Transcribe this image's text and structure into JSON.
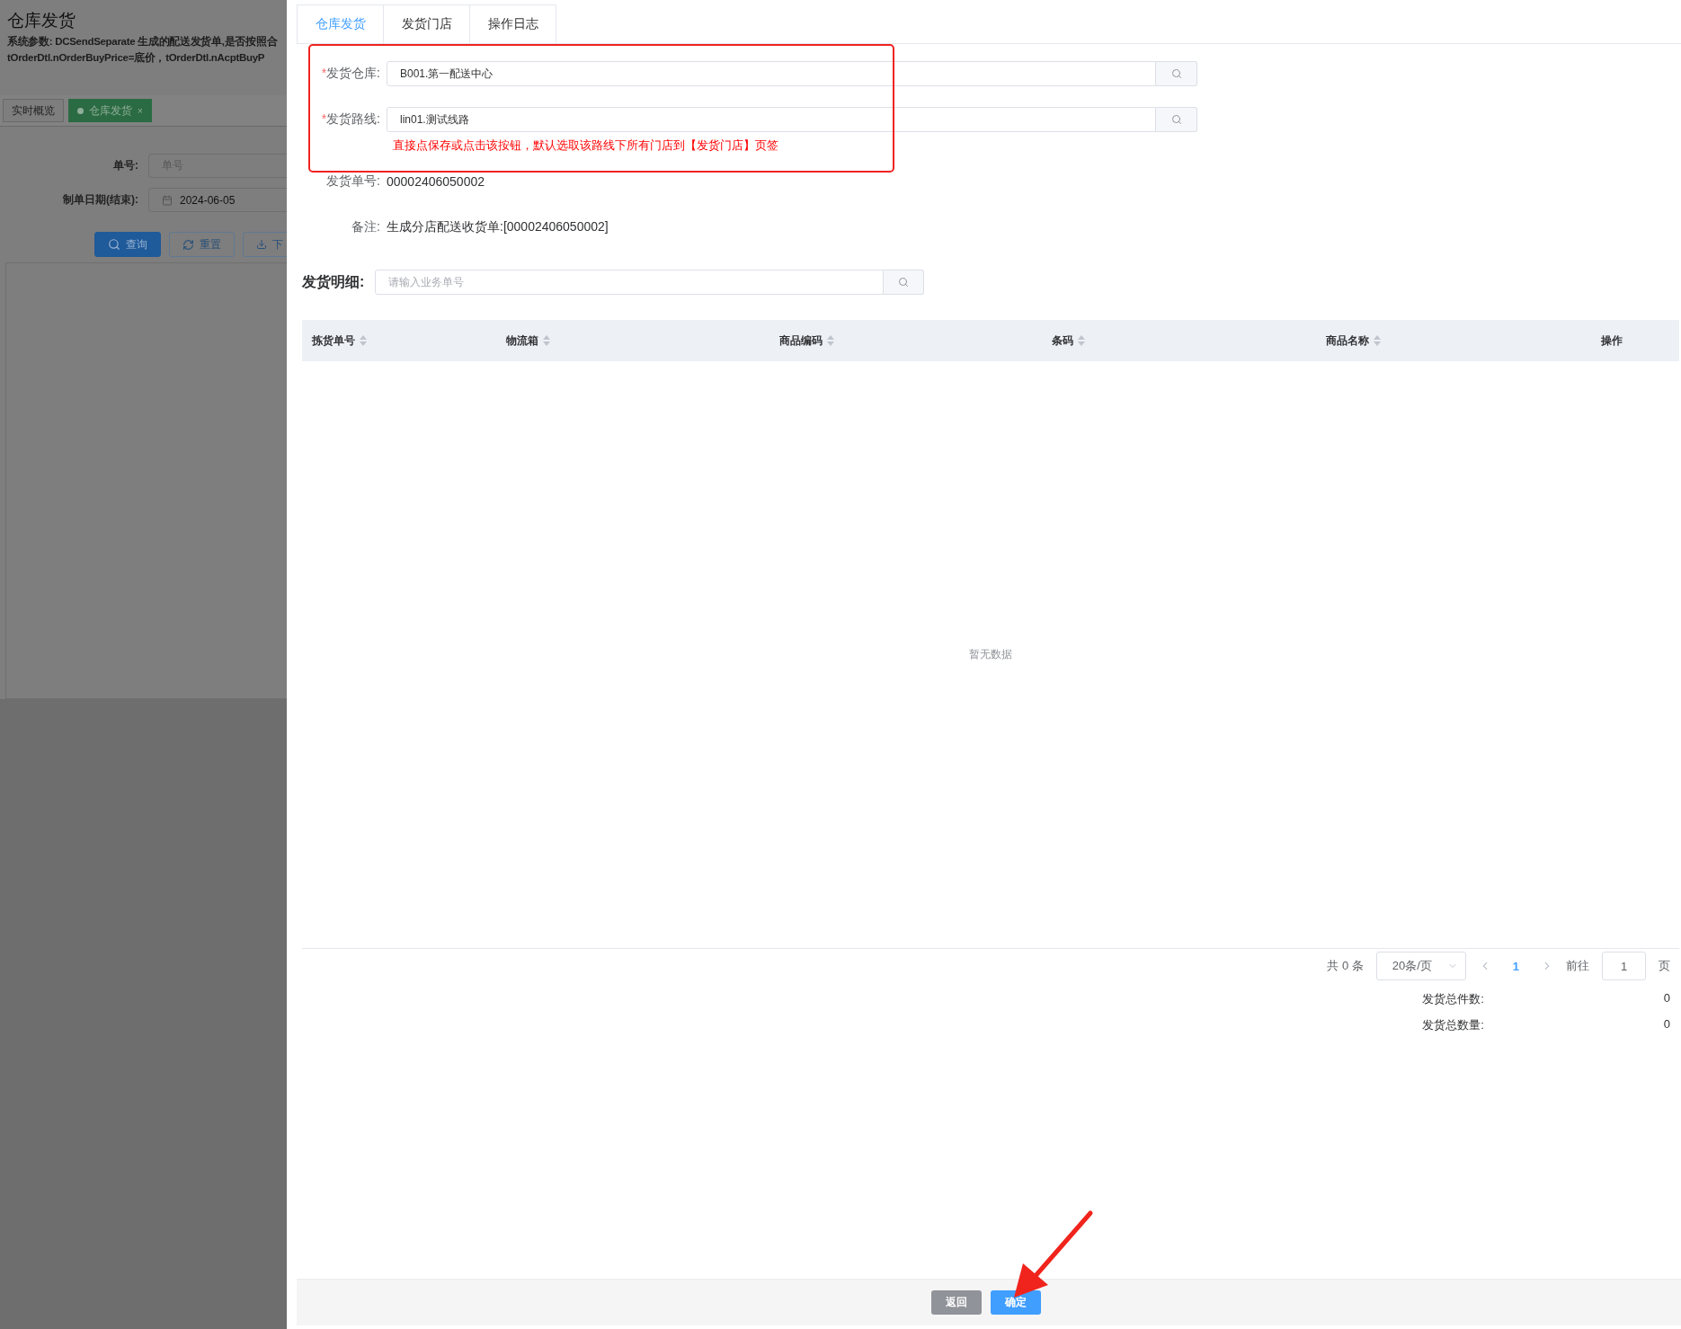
{
  "background_page": {
    "title": "仓库发货",
    "description": [
      "系统参数: DCSendSeparate 生成的配送发货单,是否按照合",
      "tOrderDtl.nOrderBuyPrice=底价，tOrderDtl.nAcptBuyP"
    ],
    "tabs": [
      {
        "label": "实时概览",
        "selected": false
      },
      {
        "label": "仓库发货",
        "selected": true,
        "close": "×"
      }
    ],
    "filters": [
      {
        "label": "单号:",
        "kind": "text",
        "placeholder": "单号"
      },
      {
        "label": "制单日期(结束):",
        "kind": "date",
        "value": "2024-06-05"
      }
    ],
    "buttons": [
      {
        "label": "查询",
        "kind": "primary"
      },
      {
        "label": "重置",
        "kind": "default"
      },
      {
        "label": "下",
        "kind": "default"
      }
    ]
  },
  "drawer": {
    "tabs": [
      {
        "label": "仓库发货",
        "selected": true
      },
      {
        "label": "发货门店",
        "selected": false
      },
      {
        "label": "操作日志",
        "selected": false
      }
    ],
    "form": {
      "fields": [
        {
          "label": "发货仓库:",
          "required_mark": "*",
          "value": "B001.第一配送中心"
        },
        {
          "label": "发货路线:",
          "required_mark": "*",
          "value": "lin01.测试线路"
        }
      ],
      "hint": "直接点保存或点击该按钮，默认选取该路线下所有门店到【发货门店】页签",
      "info": [
        {
          "label": "发货单号:",
          "value": "00002406050002"
        },
        {
          "label": "备注:",
          "value": "生成分店配送收货单:[00002406050002]"
        }
      ]
    },
    "detail": {
      "title": "发货明细:",
      "search_placeholder": "请输入业务单号"
    },
    "table": {
      "columns": [
        {
          "label": "拣货单号",
          "sortable": true
        },
        {
          "label": "物流箱",
          "sortable": true
        },
        {
          "label": "商品编码",
          "sortable": true
        },
        {
          "label": "条码",
          "sortable": true
        },
        {
          "label": "商品名称",
          "sortable": true
        },
        {
          "label": "操作",
          "sortable": false
        }
      ],
      "empty_text": "暂无数据"
    },
    "pagination": {
      "total": "共 0 条",
      "page_size": "20条/页",
      "pages": [
        {
          "label": "1",
          "selected": true
        }
      ],
      "goto_label": "前往",
      "goto_value": "1",
      "goto_suffix": "页"
    },
    "totals": [
      {
        "label": "发货总件数:",
        "value": "0"
      },
      {
        "label": "发货总数量:",
        "value": "0"
      }
    ],
    "footer_buttons": [
      {
        "label": "返回",
        "kind": "default"
      },
      {
        "label": "确定",
        "kind": "primary"
      }
    ]
  },
  "annotation": {
    "highlight_box": true,
    "arrow": true
  }
}
